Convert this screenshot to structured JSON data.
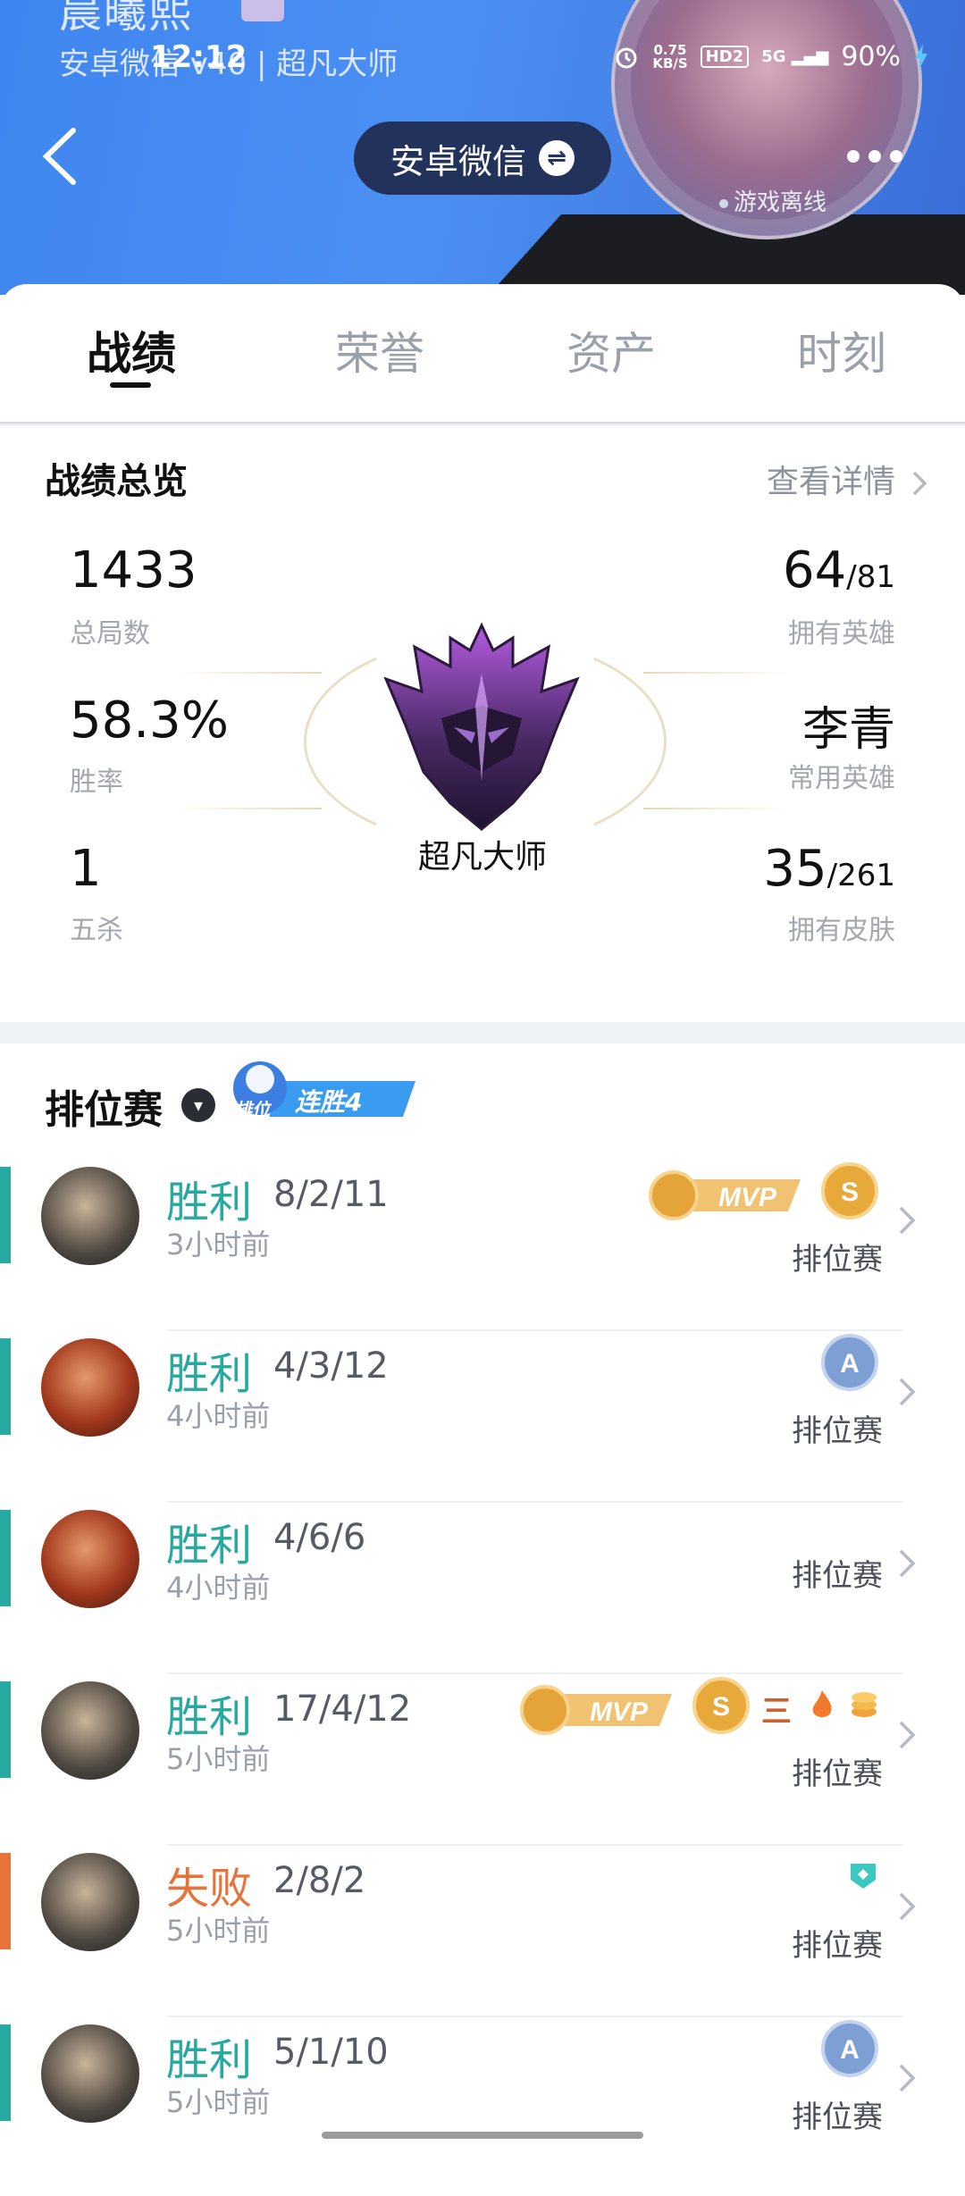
{
  "status_bar": {
    "time": "12:12",
    "net_speed": "0.75",
    "net_unit": "KB/S",
    "hd": "HD2",
    "signal": "5G",
    "battery": "90%"
  },
  "profile": {
    "name": "晨曦熙",
    "subline": "安卓微信 v40 | 超凡大师",
    "status": "游戏离线",
    "platform": "安卓微信"
  },
  "tabs": [
    {
      "label": "战绩",
      "active": true
    },
    {
      "label": "荣誉",
      "active": false
    },
    {
      "label": "资产",
      "active": false
    },
    {
      "label": "时刻",
      "active": false
    }
  ],
  "overview": {
    "title": "战绩总览",
    "details": "查看详情",
    "total_games": {
      "value": "1433",
      "label": "总局数"
    },
    "win_rate": {
      "value": "58.3%",
      "label": "胜率"
    },
    "pentakills": {
      "value": "1",
      "label": "五杀"
    },
    "heroes": {
      "value": "64",
      "total": "/81",
      "label": "拥有英雄"
    },
    "main_hero": {
      "value": "李青",
      "label": "常用英雄"
    },
    "skins": {
      "value": "35",
      "total": "/261",
      "label": "拥有皮肤"
    },
    "rank": "超凡大师"
  },
  "ranked": {
    "title": "排位赛",
    "badge_small": "排位",
    "streak": "连胜4",
    "matches": [
      {
        "result": "胜利",
        "kda": "8/2/11",
        "time": "3小时前",
        "mode": "排位赛",
        "outcome": "win"
      },
      {
        "result": "胜利",
        "kda": "4/3/12",
        "time": "4小时前",
        "mode": "排位赛",
        "outcome": "win"
      },
      {
        "result": "胜利",
        "kda": "4/6/6",
        "time": "4小时前",
        "mode": "排位赛",
        "outcome": "win"
      },
      {
        "result": "胜利",
        "kda": "17/4/12",
        "time": "5小时前",
        "mode": "排位赛",
        "outcome": "win"
      },
      {
        "result": "失败",
        "kda": "2/8/2",
        "time": "5小时前",
        "mode": "排位赛",
        "outcome": "loss"
      },
      {
        "result": "胜利",
        "kda": "5/1/10",
        "time": "5小时前",
        "mode": "排位赛",
        "outcome": "win"
      }
    ],
    "mvp_label": "MVP",
    "s_grade": "S",
    "a_grade": "A",
    "triple_mark": "三"
  },
  "colors": {
    "win": "#27a9a0",
    "loss": "#e8733a",
    "header": "#4b8ff2"
  }
}
